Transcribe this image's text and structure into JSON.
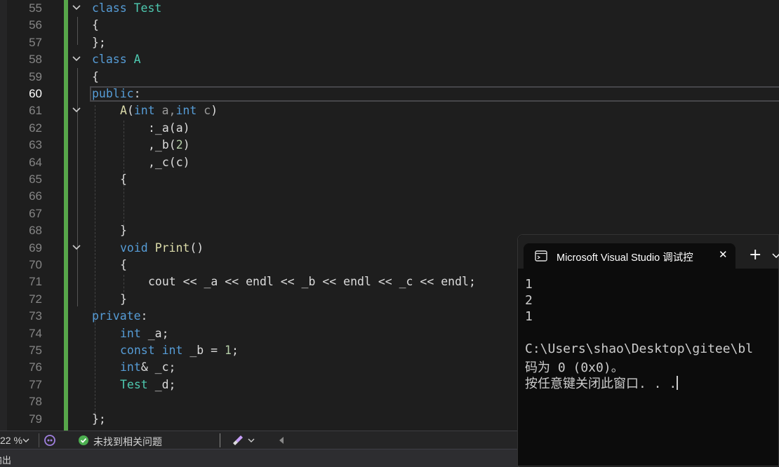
{
  "editor": {
    "lines": [
      {
        "n": "55",
        "k": "class",
        "t": "Test"
      },
      {
        "n": "56",
        "t": "{"
      },
      {
        "n": "57",
        "t": "};"
      },
      {
        "n": "58",
        "k": "class",
        "t": "A"
      },
      {
        "n": "59",
        "t": "{"
      },
      {
        "n": "60",
        "k": "public",
        "t": ":"
      },
      {
        "n": "61",
        "c1": "A",
        "c2": "(",
        "c3": "int",
        "c4": " a,",
        "c5": "int",
        "c6": " c",
        "c7": ")"
      },
      {
        "n": "62",
        "t": ":_a(a)"
      },
      {
        "n": "63",
        "t1": ",_b(",
        "t2": "2",
        "t3": ")"
      },
      {
        "n": "64",
        "t": ",_c(c)"
      },
      {
        "n": "65",
        "t": "{"
      },
      {
        "n": "66",
        "t": ""
      },
      {
        "n": "67",
        "t": ""
      },
      {
        "n": "68",
        "t": "}"
      },
      {
        "n": "69",
        "k": "void",
        "f": "Print",
        "t": "()"
      },
      {
        "n": "70",
        "t": "{"
      },
      {
        "n": "71",
        "t": "cout << _a << endl << _b << endl << _c << endl;"
      },
      {
        "n": "72",
        "t": "}"
      },
      {
        "n": "73",
        "k": "private",
        "t": ":"
      },
      {
        "n": "74",
        "k": "int",
        "t": "_a;"
      },
      {
        "n": "75",
        "k1": "const",
        "k2": "int",
        "t1": "_b = ",
        "t2": "1",
        "t3": ";"
      },
      {
        "n": "76",
        "k": "int",
        "t": "& _c;"
      },
      {
        "n": "77",
        "ty": "Test",
        "t": "_d;"
      },
      {
        "n": "78",
        "t": ""
      },
      {
        "n": "79",
        "t": "};"
      }
    ]
  },
  "status": {
    "zoom": "22 %",
    "issues": "未找到相关问题",
    "bottom_label": "输出"
  },
  "console": {
    "tab_title": "Microsoft Visual Studio 调试控",
    "close_glyph": "✕",
    "new_tab_glyph": "+",
    "output": [
      "1",
      "2",
      "1",
      "",
      "C:\\Users\\shao\\Desktop\\gitee\\bl",
      "码为 0 (0x0)。",
      "按任意键关闭此窗口. . ."
    ]
  },
  "colors": {
    "accent": "#57a64a",
    "keyword": "#569cd6",
    "type": "#4ec9b0",
    "function": "#dcdcaa"
  }
}
